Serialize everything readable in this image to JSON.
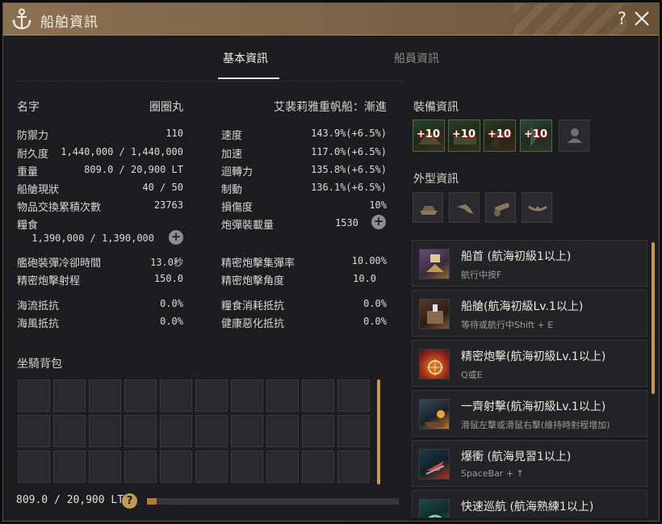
{
  "window": {
    "title": "船舶資訊",
    "help_label": "?"
  },
  "tabs": [
    {
      "label": "基本資訊",
      "active": true
    },
    {
      "label": "船員資訊",
      "active": false
    }
  ],
  "ship": {
    "name_label": "名字",
    "name_value": "圈圈丸",
    "type": "艾裴莉雅重帆船：漸進"
  },
  "stats_left": [
    {
      "label": "防禦力",
      "value": "110"
    },
    {
      "label": "耐久度",
      "value": "1,440,000 / 1,440,000"
    },
    {
      "label": "重量",
      "value": "809.0 / 20,900 LT"
    },
    {
      "label": "船艙現狀",
      "value": "40 / 50"
    },
    {
      "label": "物品交換累積次數",
      "value": "23763"
    }
  ],
  "provisions": {
    "label": "糧食",
    "value": "1,390,000 / 1,390,000"
  },
  "stats_right": [
    {
      "label": "速度",
      "value": "143.9%(+6.5%)"
    },
    {
      "label": "加速",
      "value": "117.0%(+6.5%)"
    },
    {
      "label": "迴轉力",
      "value": "135.8%(+6.5%)"
    },
    {
      "label": "制動",
      "value": "136.1%(+6.5%)"
    },
    {
      "label": "損傷度",
      "value": "10%"
    }
  ],
  "ammo": {
    "label": "炮彈裝載量",
    "value": "1530"
  },
  "cannon_stats_left": [
    {
      "label": "艦砲裝彈冷卻時間",
      "value": "13.0秒"
    },
    {
      "label": "精密炮擊射程",
      "value": "150.0"
    }
  ],
  "cannon_stats_right": [
    {
      "label": "精密炮擊集彈率",
      "value": "10.00%"
    },
    {
      "label": "精密炮擊角度",
      "value": "10.0"
    }
  ],
  "resist_left": [
    {
      "label": "海流抵抗",
      "value": "0.0%"
    },
    {
      "label": "海風抵抗",
      "value": "0.0%"
    }
  ],
  "resist_right": [
    {
      "label": "糧食消耗抵抗",
      "value": "0.0%"
    },
    {
      "label": "健康惡化抵抗",
      "value": "0.0%"
    }
  ],
  "inventory": {
    "title": "坐騎背包",
    "weight": "809.0 / 20,900 LT",
    "help": "?",
    "weight_fraction": 0.039
  },
  "equipment": {
    "title": "裝備資訊",
    "slots": [
      {
        "enhance": "+10"
      },
      {
        "enhance": "+10"
      },
      {
        "enhance": "+10"
      },
      {
        "enhance": "+10"
      }
    ]
  },
  "appearance": {
    "title": "外型資訊"
  },
  "skills": [
    {
      "name": "船首 (航海初級1以上)",
      "key": "航行中按F"
    },
    {
      "name": "船艙(航海初級Lv.1以上)",
      "key": "等待或航行中Shift + E"
    },
    {
      "name": "精密炮擊(航海初級Lv.1以上)",
      "key": "Q或E"
    },
    {
      "name": "一齊射擊(航海初級Lv.1以上)",
      "key": "滑鼠左擊或滑鼠右擊(維持時射程增加)"
    },
    {
      "name": "爆衝 (航海見習1以上)",
      "key": "SpaceBar + ↑"
    },
    {
      "name": "快速巡航 (航海熟練1以上)",
      "key": ""
    }
  ],
  "colors": {
    "title_bar": "#7a6346",
    "accent_gold": "#c49a52",
    "panel_bg": "#1c1c20",
    "enhance_red": "#c01010"
  }
}
